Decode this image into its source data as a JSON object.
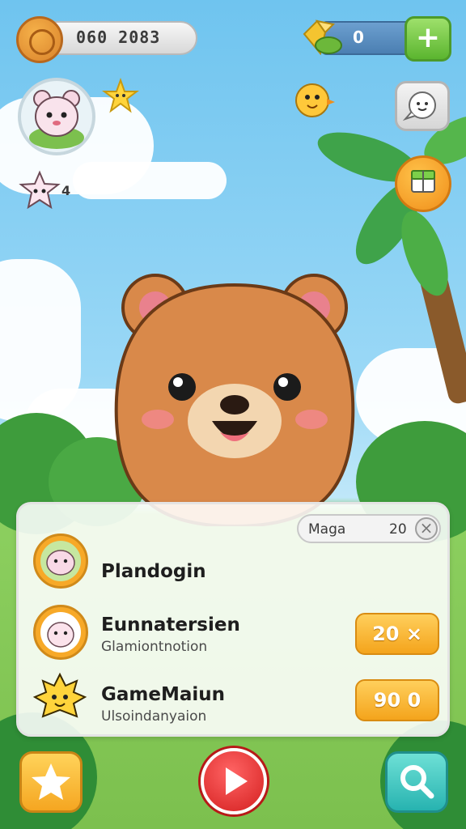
{
  "hud": {
    "coins": "060 2083",
    "gems": "0",
    "plus_label": "+"
  },
  "social": {
    "friend_count": "4"
  },
  "panel": {
    "search_label": "Maga",
    "search_count": "20",
    "close_label": "×",
    "items": [
      {
        "title": "Plandogin",
        "subtitle": "",
        "price": ""
      },
      {
        "title": "Eunnatersien",
        "subtitle": "Glamiontnotion",
        "price": "20 ×"
      },
      {
        "title": "GameMaiun",
        "subtitle": "Ulsoindanyaion",
        "price": "90 0"
      }
    ]
  },
  "colors": {
    "sky": "#8fd3f4",
    "grass": "#7cc04e",
    "bear": "#d9894a",
    "accent_orange": "#f4a41c",
    "accent_green": "#5bb52f",
    "accent_teal": "#27b3b0",
    "accent_red": "#d41f1f"
  },
  "icons": [
    "coin-icon",
    "gem-icon",
    "plus-icon",
    "avatar-icon",
    "star-icon",
    "chick-icon",
    "speech-icon",
    "gift-icon",
    "friend-icon",
    "star-button-icon",
    "play-icon",
    "search-tool-icon",
    "close-icon"
  ]
}
